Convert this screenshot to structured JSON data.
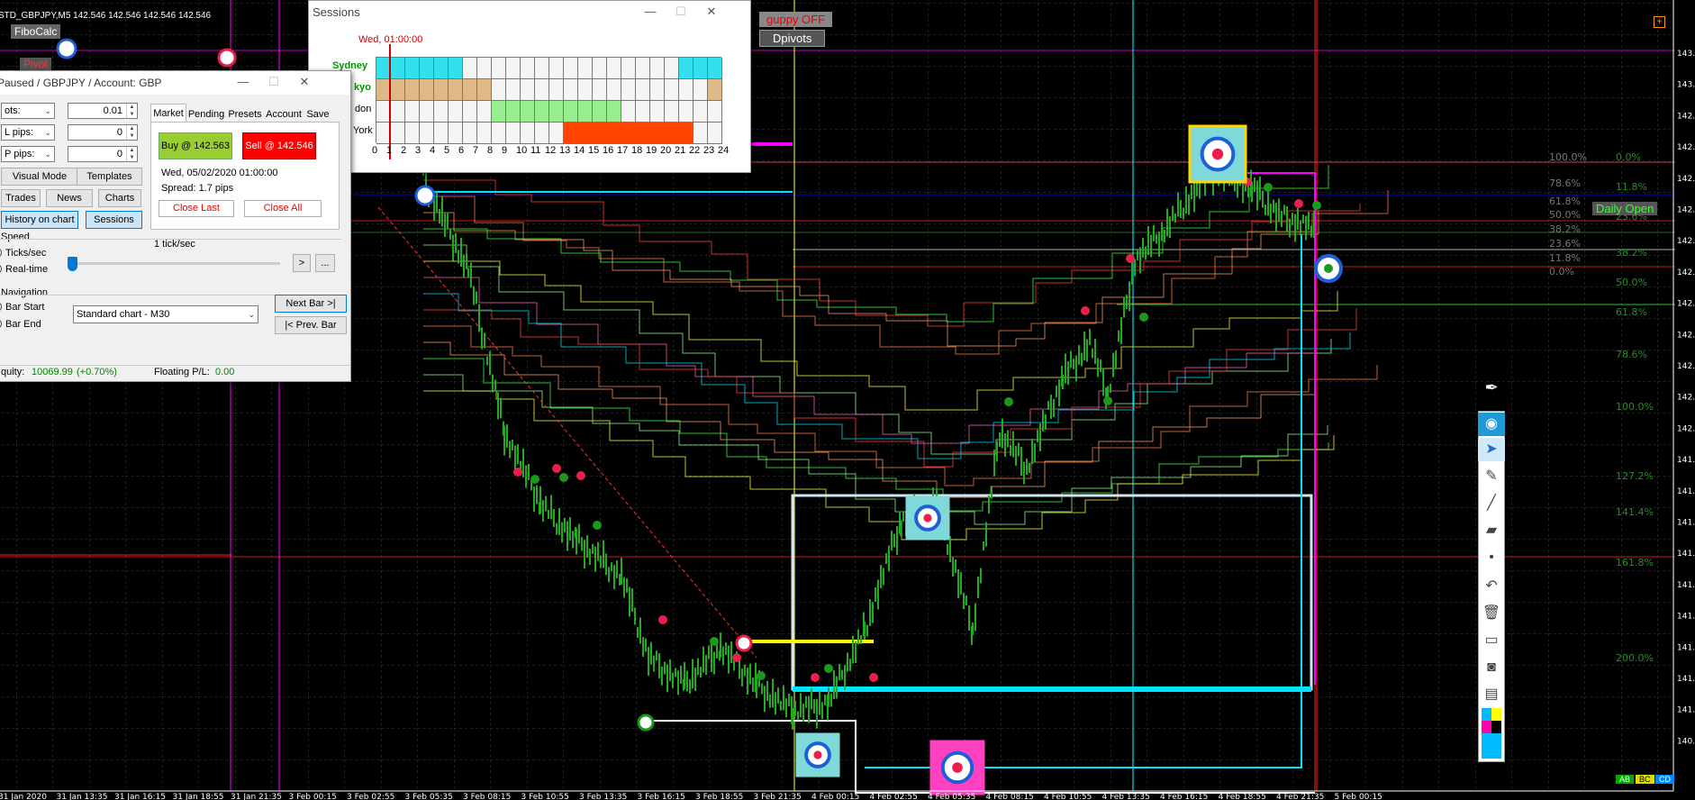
{
  "chart": {
    "symbol_bar": "STD_GBPJPY,M5  142.546 142.546 142.546 142.546",
    "fibocalc_label": "FiboCalc",
    "pivot_label": "Pivot",
    "guppy_label": "guppy OFF",
    "dpivots_label": "Dpivots",
    "daily_open_label": "Daily Open",
    "price_labels": [
      "143.",
      "143.",
      "142.",
      "142.",
      "142.",
      "142.",
      "142.",
      "142.",
      "142.",
      "142.",
      "142.",
      "142.",
      "142.",
      "141.",
      "141.",
      "141.",
      "141.",
      "141.",
      "141.",
      "141.",
      "141.",
      "141.",
      "140."
    ],
    "fib_levels_left": [
      "100.0%",
      "78.6%",
      "61.8%",
      "50.0%",
      "38.2%",
      "23.6%",
      "11.8%",
      "0.0%"
    ],
    "fib_levels_right": [
      "0.0%",
      "11.8%",
      "23.6%",
      "38.2%",
      "50.0%",
      "61.8%",
      "78.6%",
      "100.0%",
      "127.2%",
      "141.4%",
      "161.8%",
      "200.0%"
    ],
    "time_labels": [
      "31 Jan 2020",
      "31 Jan 13:35",
      "31 Jan 16:15",
      "31 Jan 18:55",
      "31 Jan 21:35",
      "3 Feb 00:15",
      "3 Feb 02:55",
      "3 Feb 05:35",
      "3 Feb 08:15",
      "3 Feb 10:55",
      "3 Feb 13:35",
      "3 Feb 16:15",
      "3 Feb 18:55",
      "3 Feb 21:35",
      "4 Feb 00:15",
      "4 Feb 02:55",
      "4 Feb 05:35",
      "4 Feb 08:15",
      "4 Feb 10:55",
      "4 Feb 13:35",
      "4 Feb 16:15",
      "4 Feb 18:55",
      "4 Feb 21:35",
      "5 Feb 00:15"
    ],
    "corner_tags": [
      "AB",
      "BC",
      "CD"
    ]
  },
  "sessions": {
    "title": "Sessions",
    "current_time": "Wed, 01:00:00",
    "rows": [
      {
        "name": "Sydney",
        "color": "#35e0ee",
        "label_color": "#009900"
      },
      {
        "name": "Tokyo",
        "color": "#deb887",
        "label_color": "#009900"
      },
      {
        "name": "London",
        "color": "#98ee90",
        "label_color": "#000000"
      },
      {
        "name": "New York",
        "color": "#ff4500",
        "label_color": "#000000"
      }
    ],
    "row_labels_visible": [
      "Sydney",
      "kyo",
      "don",
      "York"
    ],
    "hours": [
      "0",
      "1",
      "2",
      "3",
      "4",
      "5",
      "6",
      "7",
      "8",
      "9",
      "10",
      "11",
      "12",
      "13",
      "14",
      "15",
      "16",
      "17",
      "18",
      "19",
      "20",
      "21",
      "22",
      "23",
      "24"
    ]
  },
  "simulator": {
    "title": "Paused / GBPJPY / Account: GBP",
    "lots_label": "ots:",
    "lots_value": "0.01",
    "sl_label": "L pips:",
    "sl_value": "0",
    "tp_label": "P pips:",
    "tp_value": "0",
    "visual_mode": "Visual Mode",
    "templates": "Templates",
    "trades": "Trades",
    "news": "News",
    "charts": "Charts",
    "history_on_chart": "History on chart",
    "sessions_btn": "Sessions",
    "tabs": [
      "Market",
      "Pending",
      "Presets",
      "Account",
      "Save"
    ],
    "buy": "Buy @ 142.563",
    "sell": "Sell @ 142.546",
    "datetime": "Wed, 05/02/2020  01:00:00",
    "spread": "Spread: 1.7 pips",
    "close_last": "Close Last",
    "close_all": "Close All",
    "speed_label": "Speed",
    "speed_value": "1 tick/sec",
    "ticks_sec": "Ticks/sec",
    "real_time": "Real-time",
    "play_btn": ">",
    "more_btn": "...",
    "navigation_label": "Navigation",
    "bar_start": "Bar Start",
    "bar_end": "Bar End",
    "chart_select": "Standard chart - M30",
    "next_bar": "Next Bar >|",
    "prev_bar": "|< Prev. Bar",
    "equity_label": "quity:",
    "equity_value": "10069.99",
    "equity_change": "(+0.70%)",
    "floating_label": "Floating P/L:",
    "floating_value": "0.00"
  },
  "colors": {
    "buy": "#9acd32",
    "sell": "#ff0000",
    "grid": "#555555",
    "candles": "#22aa22"
  }
}
